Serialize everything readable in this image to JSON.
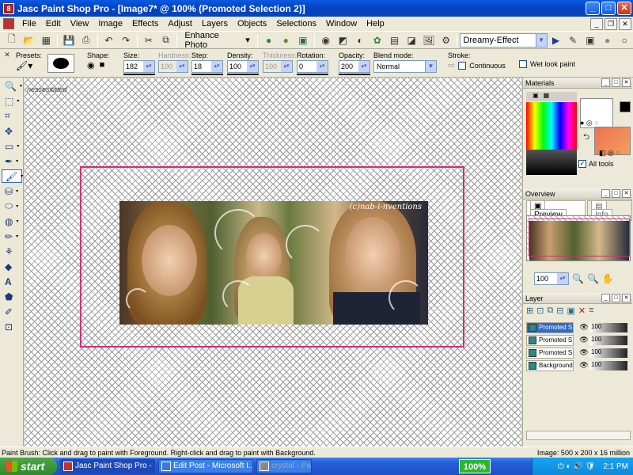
{
  "window": {
    "title": "Jasc Paint Shop Pro - [Image7* @ 100% (Promoted Selection 2)]",
    "icon": "8",
    "minimize": "_",
    "maximize": "□",
    "close": "✕"
  },
  "menu": [
    "File",
    "Edit",
    "View",
    "Image",
    "Effects",
    "Adjust",
    "Layers",
    "Objects",
    "Selections",
    "Window",
    "Help"
  ],
  "toolbar": {
    "enhance_photo": "Enhance Photo",
    "script_combo": "Dreamy-Effect"
  },
  "options": {
    "presets_label": "Presets:",
    "shape_label": "Shape:",
    "size_label": "Size:",
    "size_value": "182",
    "hardness_label": "Hardness:",
    "hardness_value": "100",
    "step_label": "Step:",
    "step_value": "18",
    "density_label": "Density:",
    "density_value": "100",
    "thickness_label": "Thickness:",
    "thickness_value": "100",
    "rotation_label": "Rotation:",
    "rotation_value": "0",
    "opacity_label": "Opacity:",
    "opacity_value": "200",
    "blend_label": "Blend mode:",
    "blend_value": "Normal",
    "stroke_label": "Stroke:",
    "continuous_label": "Continuous",
    "wet_label": "Wet look paint"
  },
  "canvas": {
    "watermark": "nessesitated",
    "photo_caption": "(c)nab-i-nventions"
  },
  "materials": {
    "title": "Materials",
    "all_tools_label": "All tools"
  },
  "overview": {
    "title": "Overview",
    "tab_preview": "Preview",
    "tab_info": "Info",
    "zoom_value": "100"
  },
  "layers": {
    "title": "Layer",
    "rows": [
      {
        "name": "Promoted S",
        "opacity": "100",
        "selected": true
      },
      {
        "name": "Promoted S",
        "opacity": "100",
        "selected": false
      },
      {
        "name": "Promoted S",
        "opacity": "100",
        "selected": false
      },
      {
        "name": "Background",
        "opacity": "100",
        "selected": false
      }
    ]
  },
  "status": {
    "left": "Paint Brush: Click and drag to paint with Foreground. Right-click and drag to paint with Background.",
    "right": "Image:  500 x 200 x 16 million"
  },
  "taskbar": {
    "start": "start",
    "tasks": [
      "Jasc Paint Shop Pro - ...",
      "Edit Post - Microsoft I...",
      "crystal - Pai"
    ],
    "percent": "100%",
    "clock": "2:1  PM"
  }
}
